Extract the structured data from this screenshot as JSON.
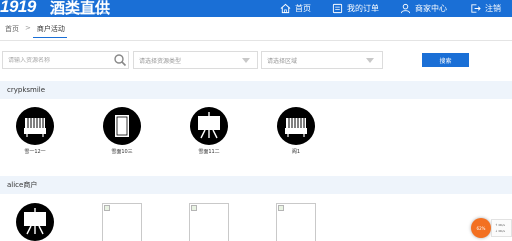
{
  "header": {
    "logo_number": "1919",
    "logo_text": "酒类直供",
    "nav": [
      {
        "label": "首页",
        "icon": "home-icon"
      },
      {
        "label": "我的订单",
        "icon": "order-icon"
      },
      {
        "label": "商家中心",
        "icon": "user-icon"
      },
      {
        "label": "注销",
        "icon": "logout-icon"
      }
    ]
  },
  "breadcrumb": {
    "home": "首页",
    "separator": ">",
    "current": "商户活动"
  },
  "filters": {
    "resource_name_placeholder": "请输入资源名称",
    "resource_type_placeholder": "请选择资源类型",
    "region_placeholder": "请选择区域",
    "search_label": "搜索"
  },
  "sections": [
    {
      "name": "crypksmile",
      "items": [
        {
          "label": "雪一12一",
          "icon": "crowd-stand-icon"
        },
        {
          "label": "雪面10三",
          "icon": "door-panel-icon"
        },
        {
          "label": "雪面11二",
          "icon": "easel-board-icon"
        },
        {
          "label": "阁1",
          "icon": "crowd-stand-icon"
        }
      ]
    },
    {
      "name": "alice商户",
      "items": [
        {
          "label": "",
          "icon": "easel-board-icon"
        },
        {
          "label": "",
          "icon": "broken-image-icon"
        },
        {
          "label": "",
          "icon": "broken-image-icon"
        },
        {
          "label": "",
          "icon": "broken-image-icon"
        }
      ]
    }
  ],
  "float_widget": {
    "badge": "62%",
    "line1": "↑ 0K/s",
    "line2": "↓ 0K/s"
  },
  "colors": {
    "brand_blue": "#1a6fd6",
    "section_bg": "#eef4fb",
    "accent_orange": "#f37021"
  }
}
